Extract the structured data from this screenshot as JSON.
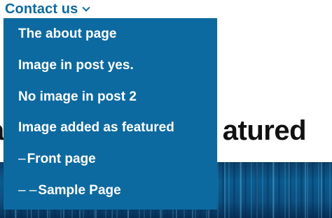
{
  "nav": {
    "link_label": "Contact us",
    "chevron_icon": "chevron-down-icon"
  },
  "background": {
    "heading_left": "a",
    "heading_right": "atured"
  },
  "dropdown": {
    "items": [
      {
        "label": "The about page",
        "prefix": ""
      },
      {
        "label": "Image in post yes.",
        "prefix": ""
      },
      {
        "label": "No image in post 2",
        "prefix": ""
      },
      {
        "label": "Image added as featured",
        "prefix": ""
      },
      {
        "label": "Front page",
        "prefix": "–"
      },
      {
        "label": "Sample Page",
        "prefix": "– –"
      }
    ]
  },
  "colors": {
    "accent": "#0d6aa0",
    "menu_text": "#ffffff",
    "heading_text": "#111111"
  }
}
